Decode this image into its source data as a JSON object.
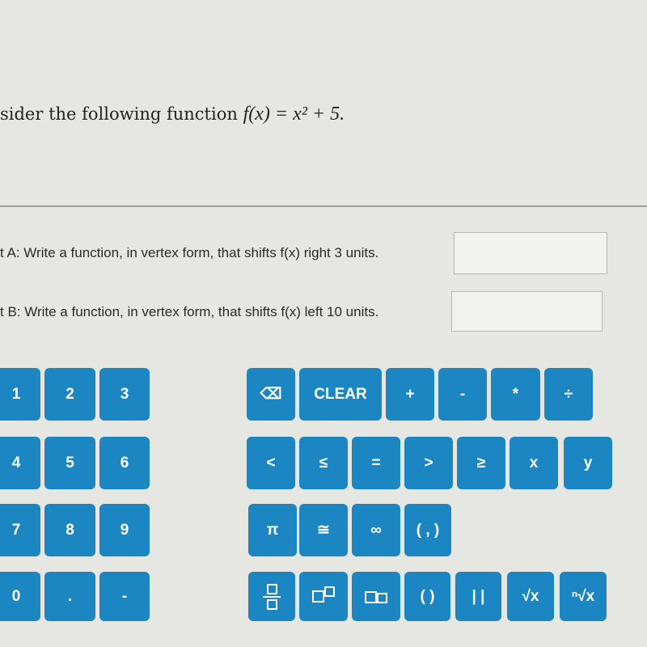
{
  "question": {
    "prefix": "sider the following function ",
    "func": "f(x) = x² + 5."
  },
  "part_a": {
    "label": "t A: Write a function, in vertex form, that shifts f(x) right 3 units.",
    "value": ""
  },
  "part_b": {
    "label": "t B: Write a function, in vertex form, that shifts f(x) left 10 units.",
    "value": ""
  },
  "keypad": {
    "numbers": [
      "1",
      "2",
      "3",
      "4",
      "5",
      "6",
      "7",
      "8",
      "9",
      "0",
      ".",
      "-"
    ],
    "ops_row1": [
      "⌫",
      "CLEAR",
      "+",
      "-",
      "*",
      "÷"
    ],
    "ops_row2": [
      "<",
      "≤",
      "=",
      ">",
      "≥",
      "x",
      "y"
    ],
    "ops_row3": [
      "π",
      "≅",
      "∞",
      "( , )"
    ],
    "ops_row4": [
      "fraction",
      "superscript",
      "subscript",
      "( )",
      "| |",
      "√x",
      "ⁿ√x"
    ]
  },
  "colors": {
    "key": "#1b86c2",
    "background": "#e6e6e3"
  }
}
